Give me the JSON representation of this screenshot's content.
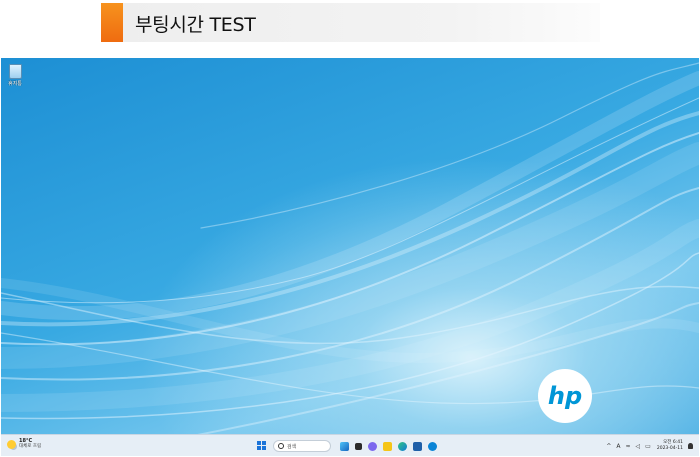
{
  "header": {
    "title": "부팅시간 TEST",
    "accent_color": "#f7931e"
  },
  "desktop": {
    "icons": [
      {
        "label": "휴지통",
        "icon": "recycle-bin-icon"
      }
    ],
    "logo": {
      "text": "hp"
    }
  },
  "taskbar": {
    "weather": {
      "temperature": "18°C",
      "condition": "대체로 흐림",
      "icon": "partly-cloudy-icon"
    },
    "search_placeholder": "검색",
    "pinned": [
      "widgets-icon",
      "task-view-icon",
      "chat-icon",
      "file-explorer-icon",
      "edge-icon",
      "store-icon",
      "help-icon"
    ],
    "tray": {
      "ime": "A",
      "time": "오전 6:41",
      "date": "2023-04-11"
    }
  }
}
